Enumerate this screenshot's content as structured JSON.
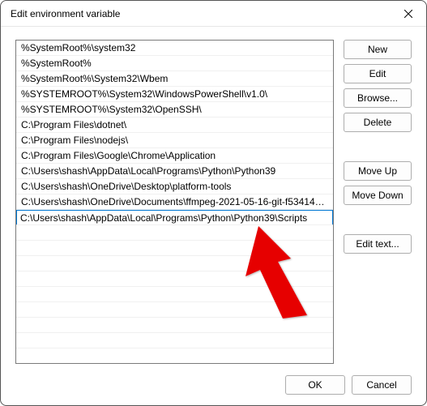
{
  "window": {
    "title": "Edit environment variable"
  },
  "list": {
    "items": [
      "%SystemRoot%\\system32",
      "%SystemRoot%",
      "%SystemRoot%\\System32\\Wbem",
      "%SYSTEMROOT%\\System32\\WindowsPowerShell\\v1.0\\",
      "%SYSTEMROOT%\\System32\\OpenSSH\\",
      "C:\\Program Files\\dotnet\\",
      "C:\\Program Files\\nodejs\\",
      "C:\\Program Files\\Google\\Chrome\\Application",
      "C:\\Users\\shash\\AppData\\Local\\Programs\\Python\\Python39",
      "C:\\Users\\shash\\OneDrive\\Desktop\\platform-tools",
      "C:\\Users\\shash\\OneDrive\\Documents\\ffmpeg-2021-05-16-git-f53414a..."
    ],
    "editing_value": "C:\\Users\\shash\\AppData\\Local\\Programs\\Python\\Python39\\Scripts",
    "editing_index": 11
  },
  "buttons": {
    "new": "New",
    "edit": "Edit",
    "browse": "Browse...",
    "delete": "Delete",
    "move_up": "Move Up",
    "move_down": "Move Down",
    "edit_text": "Edit text...",
    "ok": "OK",
    "cancel": "Cancel"
  }
}
